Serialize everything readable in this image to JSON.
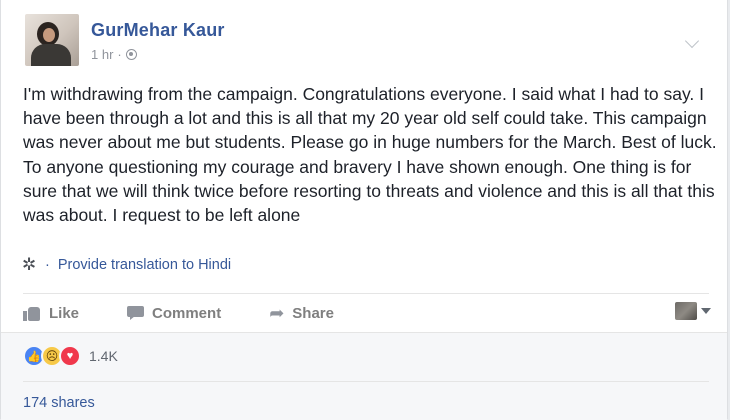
{
  "post": {
    "author": "GurMehar Kaur",
    "time": "1 hr",
    "meta_sep": "·",
    "text": "I'm withdrawing from the campaign. Congratulations everyone. I said what I had to say. I have been through a lot and this is all that my 20 year old self could take. This campaign was never about me but students. Please go in huge numbers for the March. Best of luck. To anyone questioning my courage and bravery I have shown enough. One thing is for sure that we will think twice before resorting to threats and violence and this is all that this was about. I request to be left alone",
    "translate_sep": "·",
    "translate_label": "Provide translation to Hindi",
    "privacy_icon": "globe-icon",
    "menu_icon": "chevron-down-icon"
  },
  "actions": {
    "like_label": "Like",
    "comment_label": "Comment",
    "share_label": "Share"
  },
  "reactions": {
    "icons": [
      "like-reaction",
      "sad-reaction",
      "love-reaction"
    ],
    "count": "1.4K"
  },
  "shares_label": "174 shares",
  "colors": {
    "link": "#365899",
    "text": "#1d2129",
    "muted": "#90949c",
    "like_blue": "#4a84f3",
    "love_red": "#f0384c",
    "sad_yellow": "#f7c948"
  }
}
